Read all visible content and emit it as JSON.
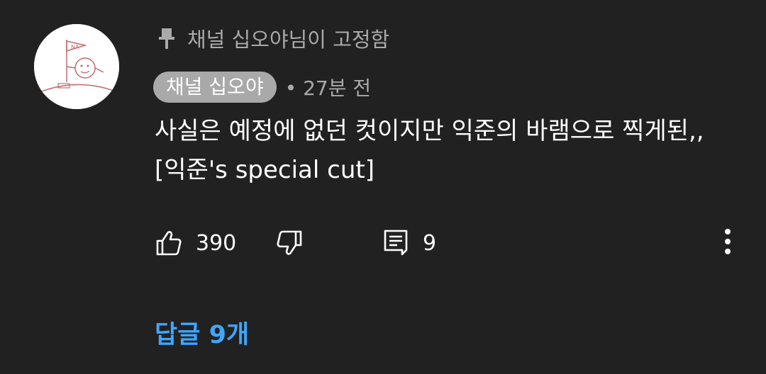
{
  "comment": {
    "pinned_label": "채널 십오야님이 고정함",
    "author": "채널 십오야",
    "time": "• 27분 전",
    "text": "사실은 예정에 없던 컷이지만 익준의 바램으로 찍게된,, [익준's special cut]",
    "like_count": "390",
    "reply_count": "9",
    "replies_link": "답글 9개"
  },
  "avatar": {
    "flag_text": "NA"
  },
  "icons": {
    "pin": "pin-icon",
    "like": "thumbs-up-icon",
    "dislike": "thumbs-down-icon",
    "reply": "comment-icon",
    "more": "more-vertical-icon"
  },
  "colors": {
    "background": "#212121",
    "secondary_text": "#aaaaaa",
    "author_chip": "#a9a9a9",
    "link": "#3ea6ff"
  }
}
